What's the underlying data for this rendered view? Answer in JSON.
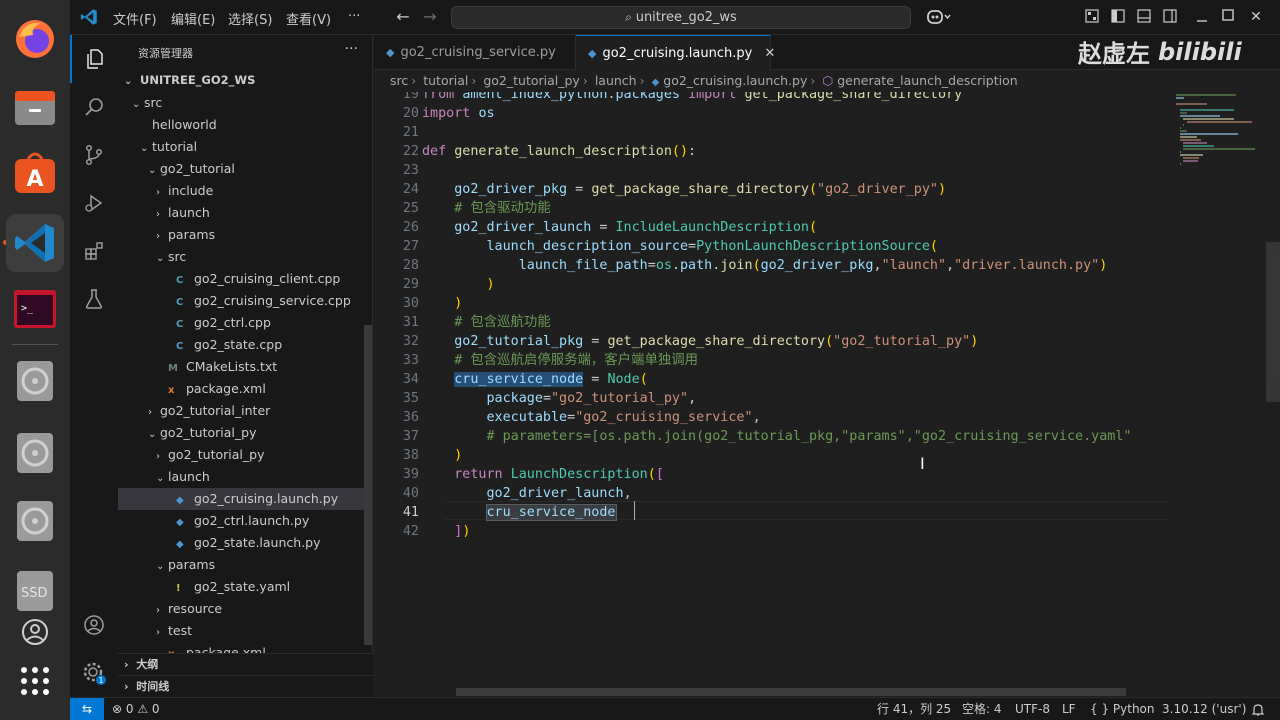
{
  "titlebar": {
    "menu": [
      "文件(F)",
      "编辑(E)",
      "选择(S)",
      "查看(V)",
      "···"
    ],
    "search": "unitree_go2_ws"
  },
  "dock": {
    "apps": [
      "firefox-icon",
      "files-icon",
      "app-center-icon",
      "vscode-icon",
      "terminal-icon",
      "disc-icon",
      "disc-icon",
      "disc-icon",
      "ssd-icon",
      "drive-icon",
      "apps-grid-icon"
    ],
    "ssd_label": "SSD"
  },
  "sidebar": {
    "title": "资源管理器",
    "more": "···",
    "workspace": "UNITREE_GO2_WS",
    "tree": [
      {
        "label": "src",
        "indent": 1,
        "chev": "⌄",
        "icon": ""
      },
      {
        "label": "helloworld",
        "indent": 2,
        "chev": "",
        "icon": ""
      },
      {
        "label": "tutorial",
        "indent": 2,
        "chev": "⌄",
        "icon": ""
      },
      {
        "label": "go2_tutorial",
        "indent": 3,
        "chev": "⌄",
        "icon": ""
      },
      {
        "label": "include",
        "indent": 4,
        "chev": "›",
        "icon": ""
      },
      {
        "label": "launch",
        "indent": 4,
        "chev": "›",
        "icon": ""
      },
      {
        "label": "params",
        "indent": 4,
        "chev": "›",
        "icon": ""
      },
      {
        "label": "src",
        "indent": 4,
        "chev": "⌄",
        "icon": ""
      },
      {
        "label": "go2_cruising_client.cpp",
        "indent": 5,
        "chev": "",
        "icon": "C"
      },
      {
        "label": "go2_cruising_service.cpp",
        "indent": 5,
        "chev": "",
        "icon": "C"
      },
      {
        "label": "go2_ctrl.cpp",
        "indent": 5,
        "chev": "",
        "icon": "C"
      },
      {
        "label": "go2_state.cpp",
        "indent": 5,
        "chev": "",
        "icon": "C"
      },
      {
        "label": "CMakeLists.txt",
        "indent": 4,
        "chev": "",
        "icon": "M"
      },
      {
        "label": "package.xml",
        "indent": 4,
        "chev": "",
        "icon": "x"
      },
      {
        "label": "go2_tutorial_inter",
        "indent": 3,
        "chev": "›",
        "icon": ""
      },
      {
        "label": "go2_tutorial_py",
        "indent": 3,
        "chev": "⌄",
        "icon": ""
      },
      {
        "label": "go2_tutorial_py",
        "indent": 4,
        "chev": "›",
        "icon": ""
      },
      {
        "label": "launch",
        "indent": 4,
        "chev": "⌄",
        "icon": ""
      },
      {
        "label": "go2_cruising.launch.py",
        "indent": 5,
        "chev": "",
        "icon": "py",
        "selected": true
      },
      {
        "label": "go2_ctrl.launch.py",
        "indent": 5,
        "chev": "",
        "icon": "py"
      },
      {
        "label": "go2_state.launch.py",
        "indent": 5,
        "chev": "",
        "icon": "py"
      },
      {
        "label": "params",
        "indent": 4,
        "chev": "⌄",
        "icon": ""
      },
      {
        "label": "go2_state.yaml",
        "indent": 5,
        "chev": "",
        "icon": "!"
      },
      {
        "label": "resource",
        "indent": 4,
        "chev": "›",
        "icon": ""
      },
      {
        "label": "test",
        "indent": 4,
        "chev": "›",
        "icon": ""
      },
      {
        "label": "package.xml",
        "indent": 4,
        "chev": "",
        "icon": "x"
      }
    ],
    "outline": "大纲",
    "timeline": "时间线"
  },
  "tabs": [
    {
      "label": "go2_cruising_service.py",
      "active": false
    },
    {
      "label": "go2_cruising.launch.py",
      "active": true
    }
  ],
  "breadcrumb": [
    "src",
    "tutorial",
    "go2_tutorial_py",
    "launch",
    "go2_cruising.launch.py",
    "generate_launch_description"
  ],
  "editor": {
    "current_line": 41,
    "lines": [
      {
        "n": "19",
        "t": "from ament_index_python.packages import get_package_share_directory"
      },
      {
        "n": "20",
        "t": "import os"
      },
      {
        "n": "21",
        "t": ""
      },
      {
        "n": "22",
        "t": "def generate_launch_description():"
      },
      {
        "n": "23",
        "t": ""
      },
      {
        "n": "24",
        "t": "    go2_driver_pkg = get_package_share_directory(\"go2_driver_py\")"
      },
      {
        "n": "25",
        "t": "    # 包含驱动功能"
      },
      {
        "n": "26",
        "t": "    go2_driver_launch = IncludeLaunchDescription("
      },
      {
        "n": "27",
        "t": "        launch_description_source=PythonLaunchDescriptionSource("
      },
      {
        "n": "28",
        "t": "            launch_file_path=os.path.join(go2_driver_pkg,\"launch\",\"driver.launch.py\")"
      },
      {
        "n": "29",
        "t": "        )"
      },
      {
        "n": "30",
        "t": "    )"
      },
      {
        "n": "31",
        "t": "    # 包含巡航功能"
      },
      {
        "n": "32",
        "t": "    go2_tutorial_pkg = get_package_share_directory(\"go2_tutorial_py\")"
      },
      {
        "n": "33",
        "t": "    # 包含巡航启停服务端，客户端单独调用"
      },
      {
        "n": "34",
        "t": "    cru_service_node = Node("
      },
      {
        "n": "35",
        "t": "        package=\"go2_tutorial_py\","
      },
      {
        "n": "36",
        "t": "        executable=\"go2_cruising_service\","
      },
      {
        "n": "37",
        "t": "        # parameters=[os.path.join(go2_tutorial_pkg,\"params\",\"go2_cruising_service.yaml\""
      },
      {
        "n": "38",
        "t": "    )"
      },
      {
        "n": "39",
        "t": "    return LaunchDescription(["
      },
      {
        "n": "40",
        "t": "        go2_driver_launch,"
      },
      {
        "n": "41",
        "t": "        cru_service_node"
      },
      {
        "n": "42",
        "t": "    ])"
      }
    ]
  },
  "statusbar": {
    "remote": "⇆",
    "problems": "⊗ 0 ⚠ 0",
    "position": "行 41，列 25",
    "spaces": "空格: 4",
    "encoding": "UTF-8",
    "eol": "LF",
    "language": "{ } Python",
    "interpreter": "3.10.12 ('usr')"
  },
  "watermark": {
    "name": "赵虚左",
    "logo": "bilibili"
  },
  "colors": {
    "accent": "#0078d4",
    "ubuntu_orange": "#e95420",
    "keyword": "#c586c0",
    "function": "#dcdcaa",
    "string": "#ce9178",
    "comment": "#6a9955",
    "class": "#4ec9b0",
    "variable": "#9cdcfe"
  }
}
